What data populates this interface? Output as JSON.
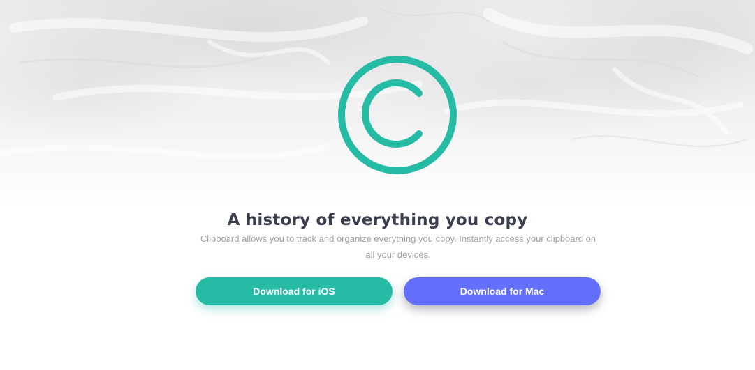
{
  "hero": {
    "logo_icon": "copyright-c-icon",
    "accent_color": "#26bba4",
    "headline": "A history of everything you copy",
    "subtitle": "Clipboard allows you to track and organize everything you copy. Instantly access your clipboard on all your devices."
  },
  "buttons": {
    "ios_label": "Download for iOS",
    "ios_color": "#26bba4",
    "mac_label": "Download for Mac",
    "mac_color": "#6470fb"
  }
}
